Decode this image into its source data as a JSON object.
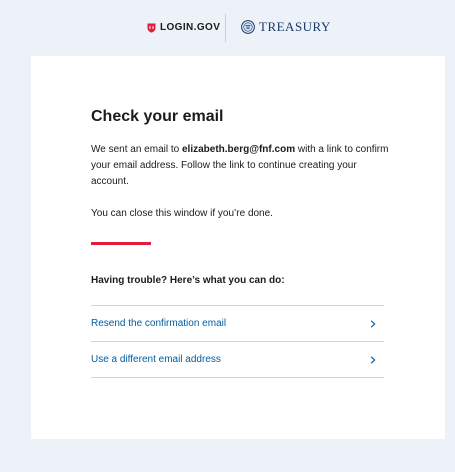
{
  "header": {
    "login_brand": "LOGIN.GOV",
    "agency_brand": "TREASURY"
  },
  "main": {
    "title": "Check your email",
    "intro_before": "We sent an email to ",
    "email": "elizabeth.berg@fnf.com",
    "intro_after": " with a link to confirm your email address. Follow the link to continue creating your account.",
    "close_note": "You can close this window if you’re done.",
    "trouble_heading": "Having trouble? Here’s what you can do:",
    "options": [
      {
        "label": "Resend the confirmation email"
      },
      {
        "label": "Use a different email address"
      }
    ]
  },
  "colors": {
    "page_background": "#edf2f9",
    "card_background": "#ffffff",
    "accent_rule": "#e21c3d",
    "link": "#005ea2",
    "login_shield": "#e21c3d",
    "agency_blue": "#1a3a6b"
  },
  "icons": {
    "login_logo": "shield-icon",
    "agency_logo": "treasury-seal-icon",
    "option_arrow": "chevron-right-icon"
  }
}
